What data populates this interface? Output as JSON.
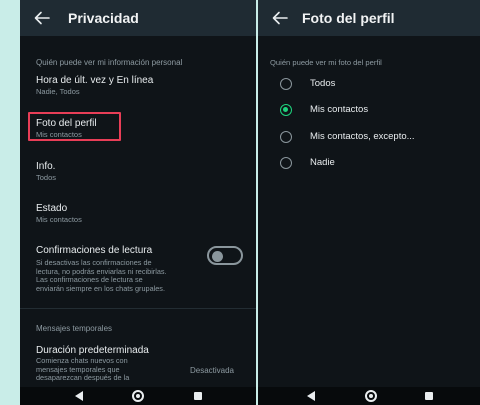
{
  "left": {
    "title": "Privacidad",
    "section_personal": "Quién puede ver mi información personal",
    "items": [
      {
        "title": "Hora de últ. vez y En línea",
        "subtitle": "Nadie, Todos"
      },
      {
        "title": "Foto del perfil",
        "subtitle": "Mis contactos"
      },
      {
        "title": "Info.",
        "subtitle": "Todos"
      },
      {
        "title": "Estado",
        "subtitle": "Mis contactos"
      }
    ],
    "read_receipts": {
      "title": "Confirmaciones de lectura",
      "description": "Si desactivas las confirmaciones de\nlectura, no podrás enviarlas ni recibirlas.\nLas confirmaciones de lectura se\nenviarán siempre en los chats grupales.",
      "enabled": false
    },
    "section_temporary": "Mensajes temporales",
    "default_duration": {
      "title": "Duración predeterminada",
      "description": "Comienza chats nuevos con\nmensajes temporales que\ndesaparezcan después de la",
      "value": "Desactivada"
    }
  },
  "right": {
    "title": "Foto del perfil",
    "section": "Quién puede ver mi foto del perfil",
    "options": [
      {
        "label": "Todos",
        "selected": false
      },
      {
        "label": "Mis contactos",
        "selected": true
      },
      {
        "label": "Mis contactos, excepto...",
        "selected": false
      },
      {
        "label": "Nadie",
        "selected": false
      }
    ]
  },
  "colors": {
    "accent": "#1ed37d",
    "highlight_box": "#e83e57",
    "app_bar": "#1f2b33",
    "background": "#0f1418",
    "page_background": "#c9ede8"
  },
  "icons": {
    "back": "arrow-left-icon",
    "nav_back": "triangle-back-icon",
    "nav_home": "circle-home-icon",
    "nav_recents": "square-recents-icon"
  }
}
